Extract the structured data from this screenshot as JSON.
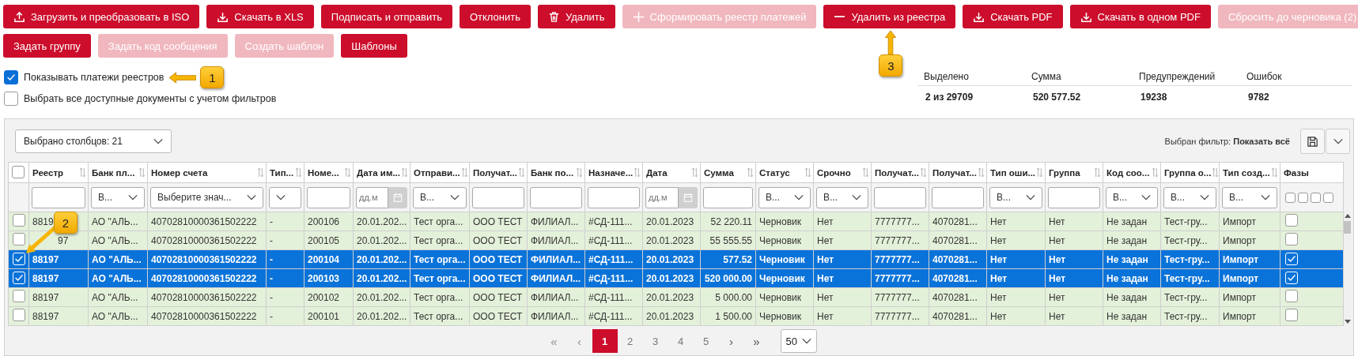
{
  "toolbar": [
    [
      {
        "label": "Загрузить и преобразовать в ISO",
        "disabled": false
      },
      {
        "label": "Скачать в XLS",
        "disabled": false
      },
      {
        "label": "Подписать и отправить",
        "disabled": false
      },
      {
        "label": "Отклонить",
        "disabled": false
      },
      {
        "label": "Удалить",
        "disabled": false
      },
      {
        "label": "Сформировать реестр платежей",
        "disabled": true
      },
      {
        "label": "Удалить из реестра",
        "disabled": false
      },
      {
        "label": "Скачать PDF",
        "disabled": false
      },
      {
        "label": "Скачать в одном PDF",
        "disabled": false
      },
      {
        "label": "Сбросить до черновика (2)",
        "disabled": true
      }
    ],
    [
      {
        "label": "Задать группу",
        "disabled": false
      },
      {
        "label": "Задать код сообщения",
        "disabled": true
      },
      {
        "label": "Создать шаблон",
        "disabled": true
      },
      {
        "label": "Шаблоны",
        "disabled": false
      }
    ]
  ],
  "options": [
    {
      "label": "Показывать платежи реестров",
      "checked": true
    },
    {
      "label": "Выбрать все доступные документы с учетом фильтров",
      "checked": false
    }
  ],
  "summary": [
    {
      "label": "Выделено",
      "value": "2 из 29709"
    },
    {
      "label": "Сумма",
      "value": "520 577.52"
    },
    {
      "label": "Предупреждений",
      "value": "19238"
    },
    {
      "label": "Ошибок",
      "value": "9782"
    }
  ],
  "column_selector": {
    "value": "Выбрано столбцов: 21"
  },
  "filter_info": "Выбран фильтр: **Показать всё**",
  "table": {
    "select_all": {
      "checked": false
    },
    "columns": [
      {
        "label": "Реестр",
        "sortable": true
      },
      {
        "label": "Банк пл...",
        "sortable": true
      },
      {
        "label": "Номер счета",
        "sortable": true
      },
      {
        "label": "Тип...",
        "sortable": true
      },
      {
        "label": "Номе...",
        "sortable": true
      },
      {
        "label": "Дата им...",
        "sortable": true
      },
      {
        "label": "Отправи...",
        "sortable": true
      },
      {
        "label": "Получат...",
        "sortable": true
      },
      {
        "label": "Банк по...",
        "sortable": true
      },
      {
        "label": "Назначе...",
        "sortable": true
      },
      {
        "label": "Дата",
        "sortable": true
      },
      {
        "label": "Сумма",
        "sortable": true
      },
      {
        "label": "Статус",
        "sortable": true
      },
      {
        "label": "Срочно",
        "sortable": true
      },
      {
        "label": "Получат...",
        "sortable": true
      },
      {
        "label": "Получат...",
        "sortable": true
      },
      {
        "label": "Тип оши...",
        "sortable": true
      },
      {
        "label": "Группа",
        "sortable": true
      },
      {
        "label": "Код соо...",
        "sortable": true
      },
      {
        "label": "Группа о...",
        "sortable": true
      },
      {
        "label": "Тип созд...",
        "sortable": true
      },
      {
        "label": "Фазы",
        "sortable": false
      }
    ],
    "filters": [
      {
        "kind": "text"
      },
      {
        "kind": "select",
        "value": "В..."
      },
      {
        "kind": "select",
        "value": "Выберите знач..."
      },
      {
        "kind": "select"
      },
      {
        "kind": "text"
      },
      {
        "kind": "date",
        "placeholder": "дд.м"
      },
      {
        "kind": "select",
        "value": "В..."
      },
      {
        "kind": "text"
      },
      {
        "kind": "text"
      },
      {
        "kind": "text"
      },
      {
        "kind": "date",
        "placeholder": "дд.м"
      },
      {
        "kind": "text"
      },
      {
        "kind": "select",
        "value": "В..."
      },
      {
        "kind": "select",
        "value": "В..."
      },
      {
        "kind": "text"
      },
      {
        "kind": "text"
      },
      {
        "kind": "select",
        "value": "В..."
      },
      {
        "kind": "text"
      },
      {
        "kind": "select",
        "value": "В..."
      },
      {
        "kind": "select",
        "value": "В..."
      },
      {
        "kind": "select",
        "value": "В..."
      },
      {
        "kind": "phases",
        "boxes": [
          {
            "checked": false
          },
          {
            "checked": false
          },
          {
            "checked": false
          },
          {
            "checked": false
          }
        ]
      }
    ],
    "rows": [
      {
        "selected": false,
        "phase": false,
        "cells": [
          "8819",
          "АО \"АЛЬ...",
          "40702810000361502222",
          "-",
          "200106",
          "20.01.202...",
          "Тест орга...",
          "ООО ТЕСТ",
          "ФИЛИАЛ...",
          "#СД-111...",
          "20.01.2023",
          "52 220.11",
          "Черновик",
          "Нет",
          "7777777...",
          "4070281...",
          "Нет",
          "Нет",
          "Не задан",
          "Тест-гру...",
          "Импорт"
        ]
      },
      {
        "selected": false,
        "phase": false,
        "cells": [
          "97",
          "АО \"АЛЬ...",
          "40702810000361502222",
          "-",
          "200105",
          "20.01.202...",
          "Тест орга...",
          "ООО ТЕСТ",
          "ФИЛИАЛ...",
          "#СД-111...",
          "20.01.2023",
          "55 555.55",
          "Черновик",
          "Нет",
          "7777777...",
          "4070281...",
          "Нет",
          "Нет",
          "Не задан",
          "Тест-гру...",
          "Импорт"
        ]
      },
      {
        "selected": true,
        "phase": true,
        "cells": [
          "88197",
          "АО \"АЛЬ...",
          "40702810000361502222",
          "-",
          "200104",
          "20.01.202...",
          "Тест орга...",
          "ООО ТЕСТ",
          "ФИЛИАЛ...",
          "#СД-111...",
          "20.01.2023",
          "577.52",
          "Черновик",
          "Нет",
          "7777777...",
          "4070281...",
          "Нет",
          "Нет",
          "Не задан",
          "Тест-гру...",
          "Импорт"
        ]
      },
      {
        "selected": true,
        "phase": true,
        "cells": [
          "88197",
          "АО \"АЛЬ...",
          "40702810000361502222",
          "-",
          "200103",
          "20.01.202...",
          "Тест орга...",
          "ООО ТЕСТ",
          "ФИЛИАЛ...",
          "#СД-111...",
          "20.01.2023",
          "520 000.00",
          "Черновик",
          "Нет",
          "7777777...",
          "4070281...",
          "Нет",
          "Нет",
          "Не задан",
          "Тест-гру...",
          "Импорт"
        ]
      },
      {
        "selected": false,
        "phase": false,
        "cells": [
          "88197",
          "АО \"АЛЬ...",
          "40702810000361502222",
          "-",
          "200102",
          "20.01.202...",
          "Тест орга...",
          "ООО ТЕСТ",
          "ФИЛИАЛ...",
          "#СД-111...",
          "20.01.2023",
          "5 000.00",
          "Черновик",
          "Нет",
          "7777777...",
          "4070281...",
          "Нет",
          "Нет",
          "Не задан",
          "Тест-гру...",
          "Импорт"
        ]
      },
      {
        "selected": false,
        "phase": false,
        "cells": [
          "88197",
          "АО \"АЛЬ...",
          "40702810000361502222",
          "-",
          "200101",
          "20.01.202...",
          "Тест орга...",
          "ООО ТЕСТ",
          "ФИЛИАЛ...",
          "#СД-111...",
          "20.01.2023",
          "1 500.00",
          "Черновик",
          "Нет",
          "7777777...",
          "4070281...",
          "Нет",
          "Нет",
          "Не задан",
          "Тест-гру...",
          "Импорт"
        ]
      }
    ]
  },
  "pagination": {
    "nav_before": [
      {
        "label": "«",
        "disabled": true
      },
      {
        "label": "‹",
        "disabled": true
      }
    ],
    "pages": [
      {
        "label": "1",
        "selected": true
      },
      {
        "label": "2",
        "selected": false
      },
      {
        "label": "3",
        "selected": false
      },
      {
        "label": "4",
        "selected": false
      },
      {
        "label": "5",
        "selected": false
      }
    ],
    "nav_after": [
      {
        "label": "›",
        "disabled": false
      },
      {
        "label": "»",
        "disabled": false
      }
    ],
    "page_size": "50"
  },
  "callouts": [
    {
      "label": "1"
    },
    {
      "label": "2"
    },
    {
      "label": "3"
    }
  ]
}
